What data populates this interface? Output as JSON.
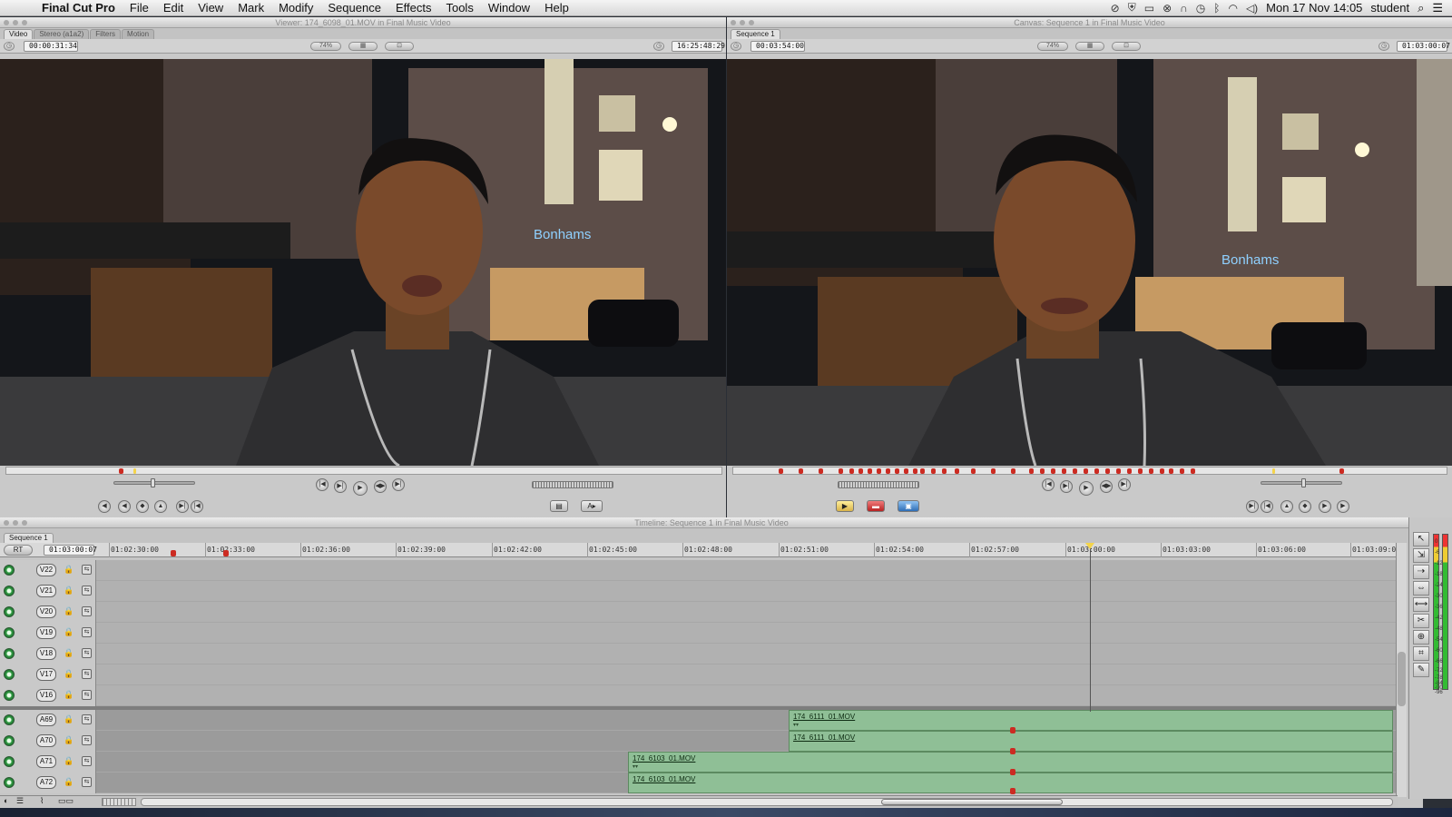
{
  "menubar": {
    "app": "Final Cut Pro",
    "items": [
      "File",
      "Edit",
      "View",
      "Mark",
      "Modify",
      "Sequence",
      "Effects",
      "Tools",
      "Window",
      "Help"
    ],
    "clock": "Mon 17 Nov  14:05",
    "user": "student"
  },
  "viewer": {
    "title": "Viewer: 174_6098_01.MOV in Final Music Video",
    "tabs": [
      "Video",
      "Stereo (a1a2)",
      "Filters",
      "Motion"
    ],
    "duration": "00:00:31:34",
    "zoom": "74%",
    "current_tc": "16:25:48:29",
    "sign_text": "Bonhams",
    "playhead_fraction": 0.18
  },
  "canvas": {
    "title": "Canvas: Sequence 1 in Final Music Video",
    "tabs": [
      "Sequence 1"
    ],
    "duration": "00:03:54:00",
    "zoom": "74%",
    "current_tc": "01:03:00:07",
    "sign_text": "Bonhams",
    "playhead_fraction": 0.76
  },
  "timeline": {
    "title": "Timeline: Sequence 1 in Final Music Video",
    "tab": "Sequence 1",
    "rt_label": "RT",
    "current_tc": "01:03:00:07",
    "ruler": [
      "01:02:30:00",
      "01:02:33:00",
      "01:02:36:00",
      "01:02:39:00",
      "01:02:42:00",
      "01:02:45:00",
      "01:02:48:00",
      "01:02:51:00",
      "01:02:54:00",
      "01:02:57:00",
      "01:03:00:00",
      "01:03:03:00",
      "01:03:06:00",
      "01:03:09:00"
    ],
    "video_tracks": [
      "V22",
      "V21",
      "V20",
      "V19",
      "V18",
      "V17",
      "V16"
    ],
    "audio_tracks": [
      "A69",
      "A70",
      "A71",
      "A72"
    ],
    "clips": [
      {
        "name": "174_6111_01.MOV",
        "track": "A69"
      },
      {
        "name": "174_6111_01.MOV",
        "track": "A70"
      },
      {
        "name": "174_6103_01.MOV",
        "track": "A71"
      },
      {
        "name": "174_6103_01.MOV",
        "track": "A72"
      }
    ]
  },
  "meters": [
    "0",
    "-6",
    "-12",
    "-18",
    "-24",
    "-30",
    "-36",
    "-42",
    "-48",
    "-54",
    "-60",
    "-66",
    "-72",
    "-78",
    "-84",
    "-90",
    "-96"
  ],
  "icons": {
    "apple": "",
    "play": "▶",
    "lock": "🔒",
    "link": "⇆",
    "search": "⌕",
    "list": "☰",
    "eye": "●"
  }
}
